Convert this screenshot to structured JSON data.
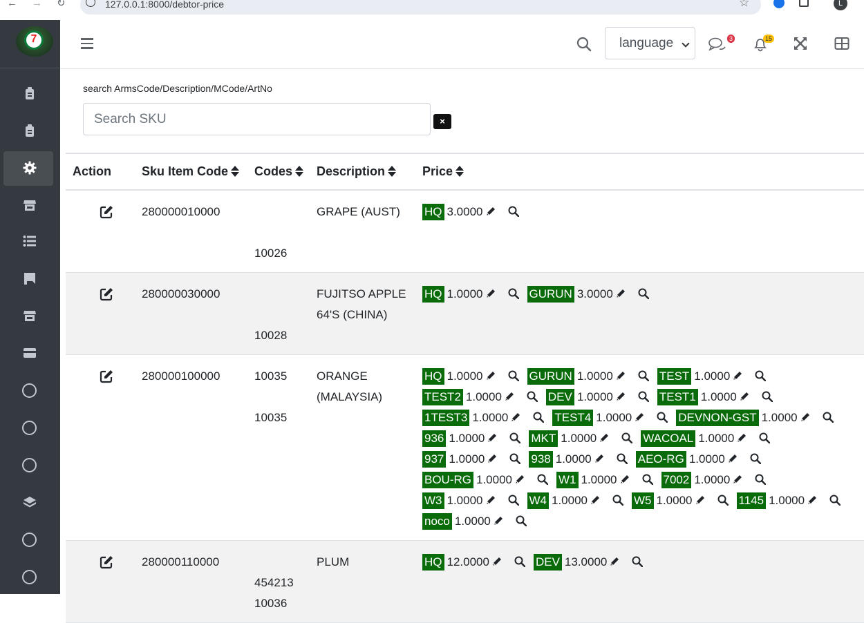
{
  "browser": {
    "url": "127.0.0.1:8000/debtor-price",
    "profile_letter": "L"
  },
  "sidebar": {
    "logo_text": "7",
    "items": [
      {
        "icon": "clipboard-icon"
      },
      {
        "icon": "clipboard-icon"
      },
      {
        "icon": "gear-icon",
        "active": true
      },
      {
        "icon": "store-icon"
      },
      {
        "icon": "list-icon"
      },
      {
        "icon": "flag-icon"
      },
      {
        "icon": "store-icon"
      },
      {
        "icon": "card-icon"
      },
      {
        "icon": "circle-icon"
      },
      {
        "icon": "circle-icon"
      },
      {
        "icon": "circle-icon"
      },
      {
        "icon": "layers-icon"
      },
      {
        "icon": "circle-icon"
      },
      {
        "icon": "circle-icon"
      }
    ]
  },
  "header": {
    "language_label": "language",
    "messages_count": "3",
    "notifications_count": "15"
  },
  "search": {
    "label": "search ArmsCode/Description/MCode/ArtNo",
    "placeholder": "Search SKU",
    "clear_label": "×"
  },
  "table": {
    "headers": {
      "action": "Action",
      "sku": "Sku Item Code",
      "codes": "Codes",
      "description": "Description",
      "price": "Price"
    },
    "rows": [
      {
        "sku": "280000010000",
        "codes": [
          "",
          "",
          "10026"
        ],
        "description": "GRAPE (AUST)",
        "prices": [
          {
            "branch": "HQ",
            "value": "3.0000"
          }
        ]
      },
      {
        "sku": "280000030000",
        "codes": [
          "",
          "",
          "10028"
        ],
        "description": "FUJITSO APPLE 64'S (CHINA)",
        "prices": [
          {
            "branch": "HQ",
            "value": "1.0000"
          },
          {
            "branch": "GURUN",
            "value": "3.0000"
          }
        ]
      },
      {
        "sku": "280000100000",
        "codes": [
          "10035",
          "",
          "10035"
        ],
        "description": "ORANGE (MALAYSIA)",
        "prices": [
          {
            "branch": "HQ",
            "value": "1.0000"
          },
          {
            "branch": "GURUN",
            "value": "1.0000"
          },
          {
            "branch": "TEST",
            "value": "1.0000"
          },
          {
            "branch": "TEST2",
            "value": "1.0000"
          },
          {
            "branch": "DEV",
            "value": "1.0000"
          },
          {
            "branch": "TEST1",
            "value": "1.0000"
          },
          {
            "branch": "1TEST3",
            "value": "1.0000"
          },
          {
            "branch": "TEST4",
            "value": "1.0000"
          },
          {
            "branch": "DEVNON-GST",
            "value": "1.0000"
          },
          {
            "branch": "936",
            "value": "1.0000"
          },
          {
            "branch": "MKT",
            "value": "1.0000"
          },
          {
            "branch": "WACOAL",
            "value": "1.0000"
          },
          {
            "branch": "937",
            "value": "1.0000"
          },
          {
            "branch": "938",
            "value": "1.0000"
          },
          {
            "branch": "AEO-RG",
            "value": "1.0000"
          },
          {
            "branch": "BOU-RG",
            "value": "1.0000"
          },
          {
            "branch": "W1",
            "value": "1.0000"
          },
          {
            "branch": "7002",
            "value": "1.0000"
          },
          {
            "branch": "W3",
            "value": "1.0000"
          },
          {
            "branch": "W4",
            "value": "1.0000"
          },
          {
            "branch": "W5",
            "value": "1.0000"
          },
          {
            "branch": "1145",
            "value": "1.0000"
          },
          {
            "branch": "noco",
            "value": "1.0000"
          }
        ]
      },
      {
        "sku": "280000110000",
        "codes": [
          "",
          "454213",
          "10036"
        ],
        "description": "PLUM",
        "prices": [
          {
            "branch": "HQ",
            "value": "12.0000"
          },
          {
            "branch": "DEV",
            "value": "13.0000"
          }
        ]
      }
    ]
  },
  "colors": {
    "tag_green": "#0a6b0a",
    "sidebar_bg": "#343a40"
  }
}
